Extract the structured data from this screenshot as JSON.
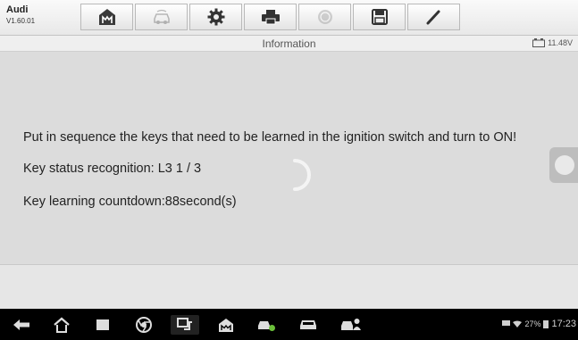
{
  "vehicle": {
    "make": "Audi",
    "version": "V1.60.01"
  },
  "toolbar": {
    "buttons": [
      {
        "icon": "home-icon"
      },
      {
        "icon": "vehicle-swap-icon"
      },
      {
        "icon": "settings-gear-icon"
      },
      {
        "icon": "print-icon"
      },
      {
        "icon": "help-icon"
      },
      {
        "icon": "save-icon"
      },
      {
        "icon": "pen-icon"
      }
    ]
  },
  "infobar": {
    "title": "Information",
    "voltage": "11.48V"
  },
  "content": {
    "line1": "Put in sequence the keys that need to be learned in the ignition switch and turn to ON!",
    "line2": "Key status recognition: L3  1 / 3",
    "line3": "Key learning countdown:88second(s)"
  },
  "statusbar": {
    "battery": "27%",
    "time": "17:23"
  },
  "colors": {
    "background": "#dcdcdc",
    "navbar": "#000000",
    "text": "#222222"
  }
}
